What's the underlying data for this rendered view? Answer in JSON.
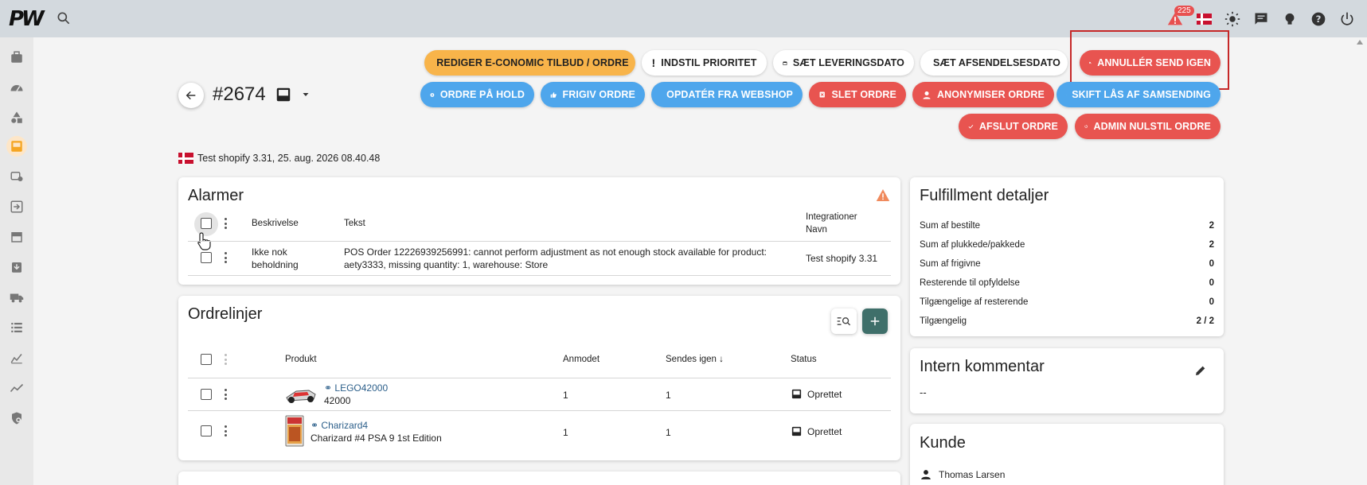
{
  "header": {
    "logo": "PW",
    "notifications_count": "225"
  },
  "actions": {
    "row1": [
      "REDIGER E-CONOMIC TILBUD / ORDRE",
      "INDSTIL PRIORITET",
      "SÆT LEVERINGSDATO",
      "SÆT AFSENDELSESDATO",
      "ANNULLÉR SEND IGEN"
    ],
    "row2": [
      "ORDRE PÅ HOLD",
      "FRIGIV ORDRE",
      "OPDATÉR FRA WEBSHOP",
      "SLET ORDRE",
      "ANONYMISER ORDRE",
      "SKIFT LÅS AF SAMSENDING"
    ],
    "row3": [
      "AFSLUT ORDRE",
      "ADMIN NULSTIL ORDRE"
    ]
  },
  "order": {
    "title": "#2674",
    "subtitle": "Test shopify 3.31, 25. aug. 2026 08.40.48"
  },
  "alarms": {
    "title": "Alarmer",
    "headers": {
      "description": "Beskrivelse",
      "text": "Tekst",
      "integration_line1": "Integrationer",
      "integration_line2": "Navn"
    },
    "rows": [
      {
        "description_line1": "Ikke nok",
        "description_line2": "beholdning",
        "text_line1": "POS Order 12226939256991: cannot perform adjustment as not enough stock available for product:",
        "text_line2": "aety3333, missing quantity: 1, warehouse: Store",
        "integration": "Test shopify 3.31"
      }
    ]
  },
  "orderlines": {
    "title": "Ordrelinjer",
    "headers": {
      "product": "Produkt",
      "requested": "Anmodet",
      "resend": "Sendes igen",
      "status": "Status"
    },
    "rows": [
      {
        "sku": "LEGO42000",
        "name": "42000",
        "requested": "1",
        "resend": "1",
        "status": "Oprettet"
      },
      {
        "sku": "Charizard4",
        "name": "Charizard #4 PSA 9 1st Edition",
        "requested": "1",
        "resend": "1",
        "status": "Oprettet"
      }
    ]
  },
  "fulfillment": {
    "title": "Fulfillment detaljer",
    "rows": [
      {
        "label": "Sum af bestilte",
        "value": "2"
      },
      {
        "label": "Sum af plukkede/pakkede",
        "value": "2"
      },
      {
        "label": "Sum af frigivne",
        "value": "0"
      },
      {
        "label": "Resterende til opfyldelse",
        "value": "0"
      },
      {
        "label": "Tilgængelige af resterende",
        "value": "0"
      },
      {
        "label": "Tilgængelig",
        "value": "2 / 2"
      }
    ]
  },
  "comment": {
    "title": "Intern kommentar",
    "value": "--"
  },
  "customer": {
    "title": "Kunde",
    "name": "Thomas Larsen"
  }
}
